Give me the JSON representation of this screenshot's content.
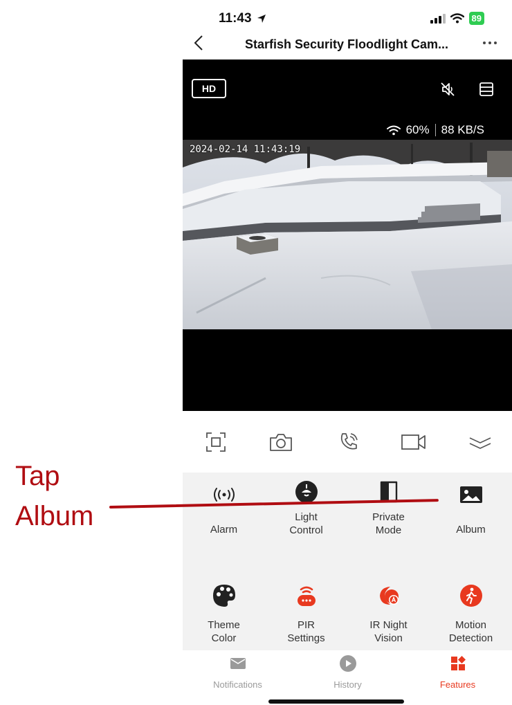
{
  "annotation": {
    "line1": "Tap",
    "line2": "Album",
    "color": "#b00d12"
  },
  "status_bar": {
    "time": "11:43",
    "battery": "89"
  },
  "header": {
    "back_icon": "chevron-left-icon",
    "title": "Starfish Security Floodlight Cam...",
    "more_icon": "ellipsis-icon"
  },
  "video": {
    "quality_label": "HD",
    "signal": "60%",
    "bitrate": "88 KB/S",
    "timestamp": "2024-02-14 11:43:19"
  },
  "toolbar": {
    "items": [
      "fullscreen-icon",
      "camera-icon",
      "phone-call-icon",
      "video-record-icon",
      "collapse-icon"
    ]
  },
  "features": {
    "items": [
      {
        "label_line1": "Alarm",
        "label_line2": "",
        "icon": "alarm-waves-icon",
        "color": "#222222"
      },
      {
        "label_line1": "Light",
        "label_line2": "Control",
        "icon": "light-bulb-icon",
        "color": "#222222"
      },
      {
        "label_line1": "Private",
        "label_line2": "Mode",
        "icon": "half-shield-icon",
        "color": "#222222"
      },
      {
        "label_line1": "Album",
        "label_line2": "",
        "icon": "image-icon",
        "color": "#222222"
      },
      {
        "label_line1": "Theme",
        "label_line2": "Color",
        "icon": "palette-icon",
        "color": "#222222"
      },
      {
        "label_line1": "PIR",
        "label_line2": "Settings",
        "icon": "pir-sensor-icon",
        "color": "#e8391f"
      },
      {
        "label_line1": "IR Night",
        "label_line2": "Vision",
        "icon": "night-vision-icon",
        "color": "#e8391f"
      },
      {
        "label_line1": "Motion",
        "label_line2": "Detection",
        "icon": "motion-person-icon",
        "color": "#e8391f"
      }
    ]
  },
  "tabs": [
    {
      "label": "Notifications",
      "icon": "envelope-icon",
      "active": false
    },
    {
      "label": "History",
      "icon": "play-circle-icon",
      "active": false
    },
    {
      "label": "Features",
      "icon": "features-grid-icon",
      "active": true
    }
  ],
  "colors": {
    "accent": "#e8391f",
    "inactive": "#9a9a9a"
  }
}
